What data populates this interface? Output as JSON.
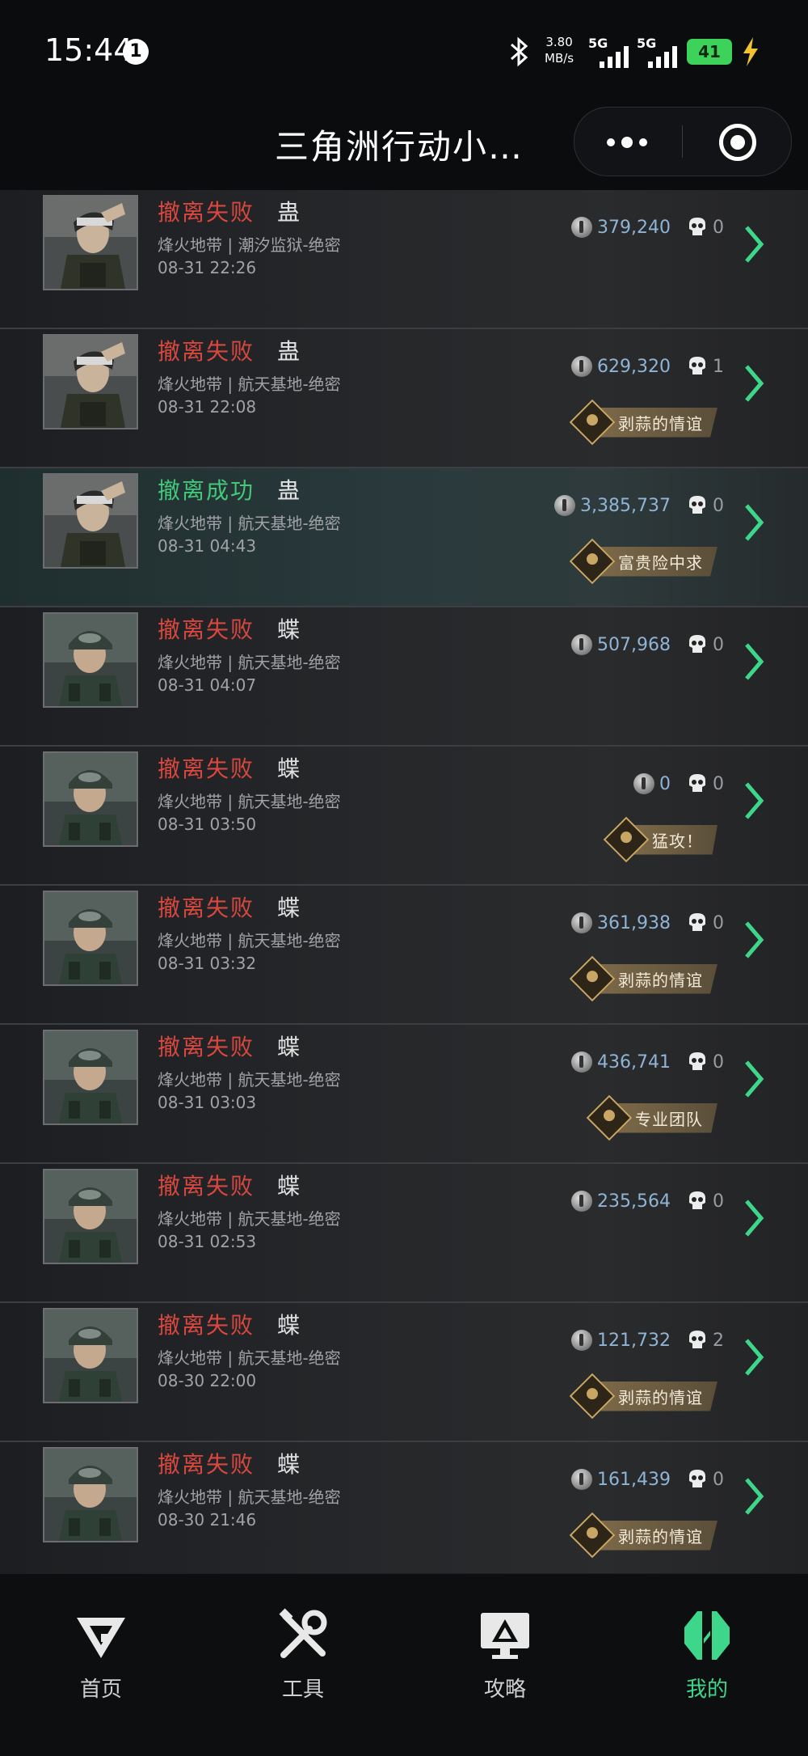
{
  "status_bar": {
    "time": "15:44",
    "notification_count": "1",
    "net_speed_value": "3.80",
    "net_speed_unit": "MB/s",
    "sim1": "5G",
    "sim2": "5G",
    "battery": "41"
  },
  "header": {
    "title": "三角洲行动小…"
  },
  "matches": [
    {
      "result": "撤离失败",
      "status": "fail",
      "operator": "蛊",
      "map": "烽火地带 | 潮汐监狱-绝密",
      "datetime": "08-31 22:26",
      "value": "379,240",
      "kills": "0",
      "badge": "",
      "avatar": "doctor"
    },
    {
      "result": "撤离失败",
      "status": "fail",
      "operator": "蛊",
      "map": "烽火地带 | 航天基地-绝密",
      "datetime": "08-31 22:08",
      "value": "629,320",
      "kills": "1",
      "badge": "剥蒜的情谊",
      "avatar": "doctor"
    },
    {
      "result": "撤离成功",
      "status": "ok",
      "operator": "蛊",
      "map": "烽火地带 | 航天基地-绝密",
      "datetime": "08-31 04:43",
      "value": "3,385,737",
      "kills": "0",
      "badge": "富贵险中求",
      "avatar": "doctor"
    },
    {
      "result": "撤离失败",
      "status": "fail",
      "operator": "蝶",
      "map": "烽火地带 | 航天基地-绝密",
      "datetime": "08-31 04:07",
      "value": "507,968",
      "kills": "0",
      "badge": "",
      "avatar": "soldier"
    },
    {
      "result": "撤离失败",
      "status": "fail",
      "operator": "蝶",
      "map": "烽火地带 | 航天基地-绝密",
      "datetime": "08-31 03:50",
      "value": "0",
      "kills": "0",
      "badge": "猛攻！",
      "avatar": "soldier"
    },
    {
      "result": "撤离失败",
      "status": "fail",
      "operator": "蝶",
      "map": "烽火地带 | 航天基地-绝密",
      "datetime": "08-31 03:32",
      "value": "361,938",
      "kills": "0",
      "badge": "剥蒜的情谊",
      "avatar": "soldier"
    },
    {
      "result": "撤离失败",
      "status": "fail",
      "operator": "蝶",
      "map": "烽火地带 | 航天基地-绝密",
      "datetime": "08-31 03:03",
      "value": "436,741",
      "kills": "0",
      "badge": "专业团队",
      "avatar": "soldier"
    },
    {
      "result": "撤离失败",
      "status": "fail",
      "operator": "蝶",
      "map": "烽火地带 | 航天基地-绝密",
      "datetime": "08-31 02:53",
      "value": "235,564",
      "kills": "0",
      "badge": "",
      "avatar": "soldier"
    },
    {
      "result": "撤离失败",
      "status": "fail",
      "operator": "蝶",
      "map": "烽火地带 | 航天基地-绝密",
      "datetime": "08-30 22:00",
      "value": "121,732",
      "kills": "2",
      "badge": "剥蒜的情谊",
      "avatar": "soldier"
    },
    {
      "result": "撤离失败",
      "status": "fail",
      "operator": "蝶",
      "map": "烽火地带 | 航天基地-绝密",
      "datetime": "08-30 21:46",
      "value": "161,439",
      "kills": "0",
      "badge": "剥蒜的情谊",
      "avatar": "soldier"
    }
  ],
  "tabs": [
    {
      "label": "首页",
      "icon": "home-logo-icon"
    },
    {
      "label": "工具",
      "icon": "tools-icon"
    },
    {
      "label": "攻略",
      "icon": "guide-monitor-icon"
    },
    {
      "label": "我的",
      "icon": "profile-logo-icon",
      "active": true
    }
  ],
  "colors": {
    "fail": "#d9473e",
    "success": "#43c87a",
    "active_tab": "#3ed68a",
    "value_text": "#8fb4d6"
  }
}
